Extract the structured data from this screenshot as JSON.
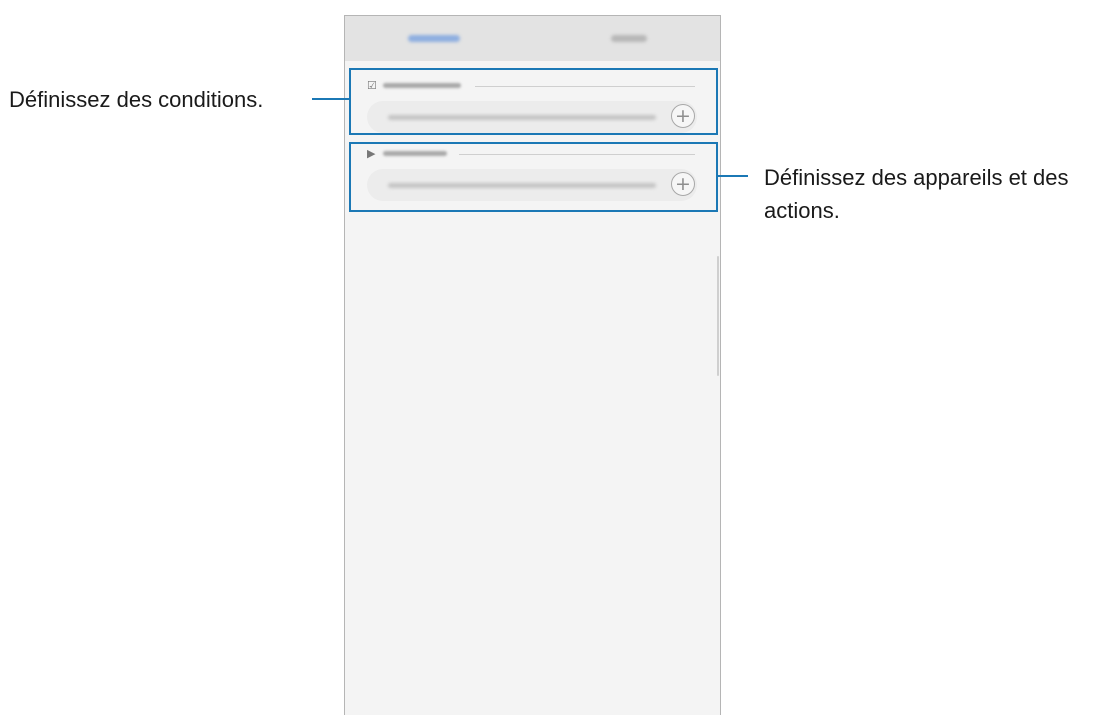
{
  "callouts": {
    "conditions": "Définissez des conditions.",
    "actions_line1": "Définissez des appareils et des",
    "actions_line2": "actions."
  },
  "icons": {
    "conditions_icon": "checkbox-icon",
    "actions_icon": "triangle-play-icon",
    "add_glyph": "+"
  },
  "colors": {
    "highlight": "#1b78b5",
    "phone_background": "#f4f4f4"
  }
}
